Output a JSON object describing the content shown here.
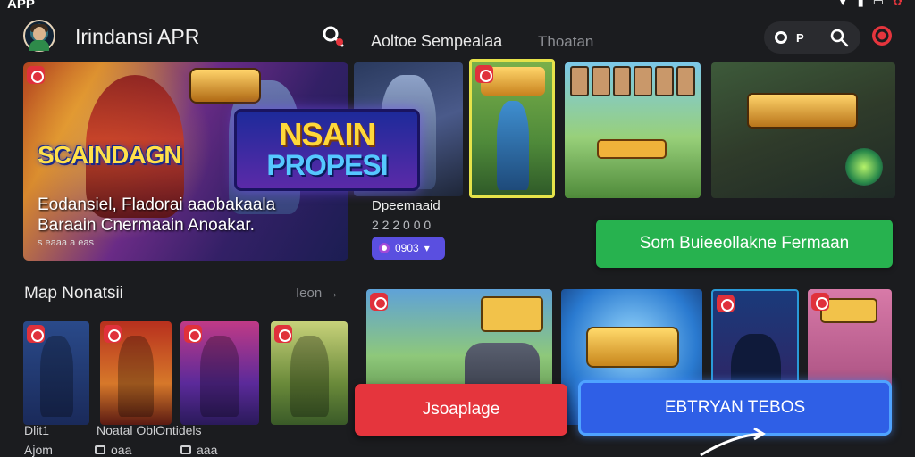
{
  "status_bar": {
    "app_label": "APP"
  },
  "header": {
    "app_title": "Irindansi APR",
    "section_title": "Aoltoe Sempealaa",
    "section_subtitle": "Thoatan",
    "record_label": "P"
  },
  "hero": {
    "title": "SCAINDAGN",
    "description_line1": "Eodansiel, Fladorai aaobakaala",
    "description_line2": "Baraain Cnermaain Anoakar.",
    "meta": "s  eaaa a  eas",
    "promo_line1": "NSAIN",
    "promo_line2": "PROPESI"
  },
  "featured": {
    "name": "Dpeemaaid",
    "meta": "2 2 2 0 0 0",
    "badge_label": "0903"
  },
  "green_button": {
    "label": "Som Buieeollakne Fermaan"
  },
  "rail": {
    "title": "Map Nonatsii",
    "more_label": "Ieon",
    "captions": [
      "Dlit1",
      "Noatal OblOntidels"
    ],
    "bottom_labels": [
      "Ajom",
      "oaa",
      "aaa"
    ]
  },
  "red_button": {
    "label": "Jsoaplage"
  },
  "blue_button": {
    "label": "EBTRYAN TEBOS"
  },
  "colors": {
    "background": "#1b1c1f",
    "green": "#27b24f",
    "red": "#e5353d",
    "blue": "#2f5fe6",
    "badge": "#5a4fe0"
  }
}
